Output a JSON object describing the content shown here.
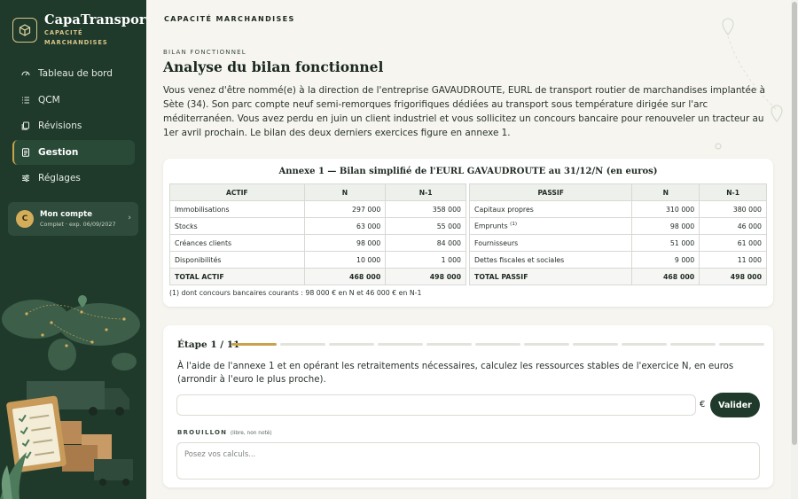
{
  "brand": {
    "title": "CapaTransport",
    "subtitle_line1": "CAPACITÉ",
    "subtitle_line2": "MARCHANDISES"
  },
  "nav": [
    {
      "label": "Tableau de bord",
      "icon": "dashboard-icon"
    },
    {
      "label": "QCM",
      "icon": "list-icon"
    },
    {
      "label": "Révisions",
      "icon": "cards-icon"
    },
    {
      "label": "Gestion",
      "icon": "document-icon",
      "active": true
    },
    {
      "label": "Réglages",
      "icon": "sliders-icon"
    }
  ],
  "account": {
    "initial": "C",
    "name": "Mon compte",
    "status": "Complet · exp. 06/09/2027"
  },
  "header": {
    "section": "CAPACITÉ MARCHANDISES"
  },
  "page": {
    "eyebrow": "BILAN FONCTIONNEL",
    "title": "Analyse du bilan fonctionnel",
    "intro": "Vous venez d'être nommé(e) à la direction de l'entreprise GAVAUDROUTE, EURL de transport routier de marchandises implantée à Sète (34). Son parc compte neuf semi-remorques frigorifiques dédiées au transport sous température dirigée sur l'arc méditerranéen. Vous avez perdu en juin un client industriel et vous sollicitez un concours bancaire pour renouveler un tracteur au 1er avril prochain. Le bilan des deux derniers exercices figure en annexe 1."
  },
  "annex": {
    "title": "Annexe 1 — Bilan simplifié de l'EURL GAVAUDROUTE au 31/12/N (en euros)",
    "actif": {
      "headers": [
        "ACTIF",
        "N",
        "N-1"
      ],
      "rows": [
        [
          "Immobilisations",
          "297 000",
          "358 000"
        ],
        [
          "Stocks",
          "63 000",
          "55 000"
        ],
        [
          "Créances clients",
          "98 000",
          "84 000"
        ],
        [
          "Disponibilités",
          "10 000",
          "1 000"
        ]
      ],
      "total": [
        "TOTAL ACTIF",
        "468 000",
        "498 000"
      ]
    },
    "passif": {
      "headers": [
        "PASSIF",
        "N",
        "N-1"
      ],
      "rows": [
        [
          "Capitaux propres",
          "310 000",
          "380 000"
        ],
        [
          "Emprunts",
          "98 000",
          "46 000"
        ],
        [
          "Fournisseurs",
          "51 000",
          "61 000"
        ],
        [
          "Dettes fiscales et sociales",
          "9 000",
          "11 000"
        ]
      ],
      "emprunts_note": "(1)",
      "total": [
        "TOTAL PASSIF",
        "468 000",
        "498 000"
      ]
    },
    "footnote": "(1) dont concours bancaires courants : 98 000 € en N et 46 000 € en N-1"
  },
  "step": {
    "label": "Étape 1 / 11",
    "current": 1,
    "total": 11,
    "question": "À l'aide de l'annexe 1 et en opérant les retraitements nécessaires, calculez les ressources stables de l'exercice N, en euros (arrondir à l'euro le plus proche).",
    "answer_value": "",
    "currency": "€",
    "validate_label": "Valider",
    "draft_label": "BROUILLON",
    "draft_hint": "(libre, non noté)",
    "draft_placeholder": "Posez vos calculs..."
  },
  "colors": {
    "sidebar": "#1f3a2b",
    "accent": "#c9a24a",
    "background": "#f6f5ef"
  }
}
